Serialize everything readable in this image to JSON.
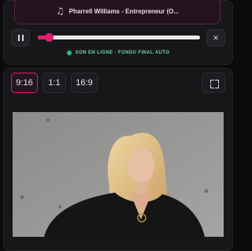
{
  "player": {
    "track_icon": "music-note-icon",
    "track_title": "Pharrell Williams - Entrepreneur (O...",
    "progress": 0.07,
    "pause_icon": "pause-icon",
    "close_icon": "close-icon",
    "close_glyph": "✕",
    "status": "SON EN LIGNE · FONDU FINAL AUTO"
  },
  "formats": {
    "options": [
      "9:16",
      "1:1",
      "16:9"
    ],
    "selected": "9:16",
    "fullscreen_icon": "fullscreen-icon"
  },
  "colors": {
    "accent": "#e0206f",
    "status": "#23c08a"
  }
}
